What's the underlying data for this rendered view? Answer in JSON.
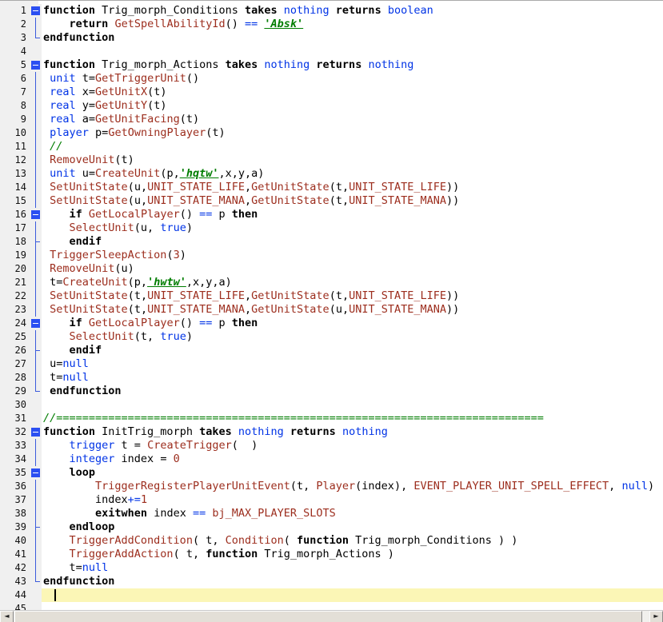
{
  "editor": {
    "current_line": 44,
    "colors": {
      "keyword": "#000000",
      "type": "#0033e6",
      "native": "#9c2d1d",
      "number": "#9c2d1d",
      "rawcode": "#007d00",
      "comment": "#007d00",
      "operator": "#0033e6",
      "plain": "#000000",
      "gutter_bg": "#f0f0f0",
      "gutter_text": "#111111",
      "fold_marker": "#2b4ff2",
      "fold_line": "#3b5bdc",
      "current_line_bg": "#fbf6b6",
      "scrollbar_track": "#f1f0ed",
      "scrollbar_thumb": "#e3dfd7"
    },
    "lines": [
      {
        "n": 1,
        "fold": "box",
        "tokens": [
          [
            "k",
            "function"
          ],
          [
            "p",
            " Trig_morph_Conditions "
          ],
          [
            "k",
            "takes"
          ],
          [
            "p",
            " "
          ],
          [
            "t",
            "nothing"
          ],
          [
            "p",
            " "
          ],
          [
            "k",
            "returns"
          ],
          [
            "p",
            " "
          ],
          [
            "t",
            "boolean"
          ]
        ]
      },
      {
        "n": 2,
        "fold": "line",
        "tokens": [
          [
            "p",
            "    "
          ],
          [
            "k",
            "return"
          ],
          [
            "p",
            " "
          ],
          [
            "f",
            "GetSpellAbilityId"
          ],
          [
            "p",
            "() "
          ],
          [
            "o",
            "=="
          ],
          [
            "p",
            " "
          ],
          [
            "s",
            "'Absk'"
          ]
        ]
      },
      {
        "n": 3,
        "fold": "corner",
        "tokens": [
          [
            "k",
            "endfunction"
          ]
        ]
      },
      {
        "n": 4,
        "fold": "",
        "tokens": []
      },
      {
        "n": 5,
        "fold": "box",
        "tokens": [
          [
            "k",
            "function"
          ],
          [
            "p",
            " Trig_morph_Actions "
          ],
          [
            "k",
            "takes"
          ],
          [
            "p",
            " "
          ],
          [
            "t",
            "nothing"
          ],
          [
            "p",
            " "
          ],
          [
            "k",
            "returns"
          ],
          [
            "p",
            " "
          ],
          [
            "t",
            "nothing"
          ]
        ]
      },
      {
        "n": 6,
        "fold": "line",
        "tokens": [
          [
            "p",
            " "
          ],
          [
            "t",
            "unit"
          ],
          [
            "p",
            " t="
          ],
          [
            "f",
            "GetTriggerUnit"
          ],
          [
            "p",
            "()"
          ]
        ]
      },
      {
        "n": 7,
        "fold": "line",
        "tokens": [
          [
            "p",
            " "
          ],
          [
            "t",
            "real"
          ],
          [
            "p",
            " x="
          ],
          [
            "f",
            "GetUnitX"
          ],
          [
            "p",
            "(t)"
          ]
        ]
      },
      {
        "n": 8,
        "fold": "line",
        "tokens": [
          [
            "p",
            " "
          ],
          [
            "t",
            "real"
          ],
          [
            "p",
            " y="
          ],
          [
            "f",
            "GetUnitY"
          ],
          [
            "p",
            "(t)"
          ]
        ]
      },
      {
        "n": 9,
        "fold": "line",
        "tokens": [
          [
            "p",
            " "
          ],
          [
            "t",
            "real"
          ],
          [
            "p",
            " a="
          ],
          [
            "f",
            "GetUnitFacing"
          ],
          [
            "p",
            "(t)"
          ]
        ]
      },
      {
        "n": 10,
        "fold": "line",
        "tokens": [
          [
            "p",
            " "
          ],
          [
            "t",
            "player"
          ],
          [
            "p",
            " p="
          ],
          [
            "f",
            "GetOwningPlayer"
          ],
          [
            "p",
            "(t)"
          ]
        ]
      },
      {
        "n": 11,
        "fold": "line",
        "tokens": [
          [
            "p",
            " "
          ],
          [
            "m",
            "//"
          ]
        ]
      },
      {
        "n": 12,
        "fold": "line",
        "tokens": [
          [
            "p",
            " "
          ],
          [
            "f",
            "RemoveUnit"
          ],
          [
            "p",
            "(t)"
          ]
        ]
      },
      {
        "n": 13,
        "fold": "line",
        "tokens": [
          [
            "p",
            " "
          ],
          [
            "t",
            "unit"
          ],
          [
            "p",
            " u="
          ],
          [
            "f",
            "CreateUnit"
          ],
          [
            "p",
            "(p,"
          ],
          [
            "s",
            "'hqtw'"
          ],
          [
            "p",
            ",x,y,a)"
          ]
        ]
      },
      {
        "n": 14,
        "fold": "line",
        "tokens": [
          [
            "p",
            " "
          ],
          [
            "f",
            "SetUnitState"
          ],
          [
            "p",
            "(u,"
          ],
          [
            "f",
            "UNIT_STATE_LIFE"
          ],
          [
            "p",
            ","
          ],
          [
            "f",
            "GetUnitState"
          ],
          [
            "p",
            "(t,"
          ],
          [
            "f",
            "UNIT_STATE_LIFE"
          ],
          [
            "p",
            "))"
          ]
        ]
      },
      {
        "n": 15,
        "fold": "line",
        "tokens": [
          [
            "p",
            " "
          ],
          [
            "f",
            "SetUnitState"
          ],
          [
            "p",
            "(u,"
          ],
          [
            "f",
            "UNIT_STATE_MANA"
          ],
          [
            "p",
            ","
          ],
          [
            "f",
            "GetUnitState"
          ],
          [
            "p",
            "(t,"
          ],
          [
            "f",
            "UNIT_STATE_MANA"
          ],
          [
            "p",
            "))"
          ]
        ]
      },
      {
        "n": 16,
        "fold": "box",
        "tokens": [
          [
            "p",
            "    "
          ],
          [
            "k",
            "if"
          ],
          [
            "p",
            " "
          ],
          [
            "f",
            "GetLocalPlayer"
          ],
          [
            "p",
            "() "
          ],
          [
            "o",
            "=="
          ],
          [
            "p",
            " p "
          ],
          [
            "k",
            "then"
          ]
        ]
      },
      {
        "n": 17,
        "fold": "line",
        "tokens": [
          [
            "p",
            "    "
          ],
          [
            "f",
            "SelectUnit"
          ],
          [
            "p",
            "(u, "
          ],
          [
            "t",
            "true"
          ],
          [
            "p",
            ")"
          ]
        ]
      },
      {
        "n": 18,
        "fold": "tee",
        "tokens": [
          [
            "p",
            "    "
          ],
          [
            "k",
            "endif"
          ]
        ]
      },
      {
        "n": 19,
        "fold": "line",
        "tokens": [
          [
            "p",
            " "
          ],
          [
            "f",
            "TriggerSleepAction"
          ],
          [
            "p",
            "("
          ],
          [
            "n",
            "3"
          ],
          [
            "p",
            ")"
          ]
        ]
      },
      {
        "n": 20,
        "fold": "line",
        "tokens": [
          [
            "p",
            " "
          ],
          [
            "f",
            "RemoveUnit"
          ],
          [
            "p",
            "(u)"
          ]
        ]
      },
      {
        "n": 21,
        "fold": "line",
        "tokens": [
          [
            "p",
            " t="
          ],
          [
            "f",
            "CreateUnit"
          ],
          [
            "p",
            "(p,"
          ],
          [
            "s",
            "'hwtw'"
          ],
          [
            "p",
            ",x,y,a)"
          ]
        ]
      },
      {
        "n": 22,
        "fold": "line",
        "tokens": [
          [
            "p",
            " "
          ],
          [
            "f",
            "SetUnitState"
          ],
          [
            "p",
            "(t,"
          ],
          [
            "f",
            "UNIT_STATE_LIFE"
          ],
          [
            "p",
            ","
          ],
          [
            "f",
            "GetUnitState"
          ],
          [
            "p",
            "(t,"
          ],
          [
            "f",
            "UNIT_STATE_LIFE"
          ],
          [
            "p",
            "))"
          ]
        ]
      },
      {
        "n": 23,
        "fold": "line",
        "tokens": [
          [
            "p",
            " "
          ],
          [
            "f",
            "SetUnitState"
          ],
          [
            "p",
            "(t,"
          ],
          [
            "f",
            "UNIT_STATE_MANA"
          ],
          [
            "p",
            ","
          ],
          [
            "f",
            "GetUnitState"
          ],
          [
            "p",
            "(u,"
          ],
          [
            "f",
            "UNIT_STATE_MANA"
          ],
          [
            "p",
            "))"
          ]
        ]
      },
      {
        "n": 24,
        "fold": "box",
        "tokens": [
          [
            "p",
            "    "
          ],
          [
            "k",
            "if"
          ],
          [
            "p",
            " "
          ],
          [
            "f",
            "GetLocalPlayer"
          ],
          [
            "p",
            "() "
          ],
          [
            "o",
            "=="
          ],
          [
            "p",
            " p "
          ],
          [
            "k",
            "then"
          ]
        ]
      },
      {
        "n": 25,
        "fold": "line",
        "tokens": [
          [
            "p",
            "    "
          ],
          [
            "f",
            "SelectUnit"
          ],
          [
            "p",
            "(t, "
          ],
          [
            "t",
            "true"
          ],
          [
            "p",
            ")"
          ]
        ]
      },
      {
        "n": 26,
        "fold": "tee",
        "tokens": [
          [
            "p",
            "    "
          ],
          [
            "k",
            "endif"
          ]
        ]
      },
      {
        "n": 27,
        "fold": "line",
        "tokens": [
          [
            "p",
            " u="
          ],
          [
            "t",
            "null"
          ]
        ]
      },
      {
        "n": 28,
        "fold": "line",
        "tokens": [
          [
            "p",
            " t="
          ],
          [
            "t",
            "null"
          ]
        ]
      },
      {
        "n": 29,
        "fold": "corner",
        "tokens": [
          [
            "p",
            " "
          ],
          [
            "k",
            "endfunction"
          ]
        ]
      },
      {
        "n": 30,
        "fold": "",
        "tokens": []
      },
      {
        "n": 31,
        "fold": "",
        "tokens": [
          [
            "m",
            "//==========================================================================="
          ]
        ]
      },
      {
        "n": 32,
        "fold": "box",
        "tokens": [
          [
            "k",
            "function"
          ],
          [
            "p",
            " InitTrig_morph "
          ],
          [
            "k",
            "takes"
          ],
          [
            "p",
            " "
          ],
          [
            "t",
            "nothing"
          ],
          [
            "p",
            " "
          ],
          [
            "k",
            "returns"
          ],
          [
            "p",
            " "
          ],
          [
            "t",
            "nothing"
          ]
        ]
      },
      {
        "n": 33,
        "fold": "line",
        "tokens": [
          [
            "p",
            "    "
          ],
          [
            "t",
            "trigger"
          ],
          [
            "p",
            " t = "
          ],
          [
            "f",
            "CreateTrigger"
          ],
          [
            "p",
            "(  )"
          ]
        ]
      },
      {
        "n": 34,
        "fold": "line",
        "tokens": [
          [
            "p",
            "    "
          ],
          [
            "t",
            "integer"
          ],
          [
            "p",
            " index = "
          ],
          [
            "n",
            "0"
          ]
        ]
      },
      {
        "n": 35,
        "fold": "box",
        "tokens": [
          [
            "p",
            "    "
          ],
          [
            "k",
            "loop"
          ]
        ]
      },
      {
        "n": 36,
        "fold": "line",
        "tokens": [
          [
            "p",
            "        "
          ],
          [
            "f",
            "TriggerRegisterPlayerUnitEvent"
          ],
          [
            "p",
            "(t, "
          ],
          [
            "f",
            "Player"
          ],
          [
            "p",
            "(index), "
          ],
          [
            "f",
            "EVENT_PLAYER_UNIT_SPELL_EFFECT"
          ],
          [
            "p",
            ", "
          ],
          [
            "t",
            "null"
          ],
          [
            "p",
            ")"
          ]
        ]
      },
      {
        "n": 37,
        "fold": "line",
        "tokens": [
          [
            "p",
            "        index"
          ],
          [
            "o",
            "+="
          ],
          [
            "n",
            "1"
          ]
        ]
      },
      {
        "n": 38,
        "fold": "line",
        "tokens": [
          [
            "p",
            "        "
          ],
          [
            "k",
            "exitwhen"
          ],
          [
            "p",
            " index "
          ],
          [
            "o",
            "=="
          ],
          [
            "p",
            " "
          ],
          [
            "f",
            "bj_MAX_PLAYER_SLOTS"
          ]
        ]
      },
      {
        "n": 39,
        "fold": "tee",
        "tokens": [
          [
            "p",
            "    "
          ],
          [
            "k",
            "endloop"
          ]
        ]
      },
      {
        "n": 40,
        "fold": "line",
        "tokens": [
          [
            "p",
            "    "
          ],
          [
            "f",
            "TriggerAddCondition"
          ],
          [
            "p",
            "( t, "
          ],
          [
            "f",
            "Condition"
          ],
          [
            "p",
            "( "
          ],
          [
            "k",
            "function"
          ],
          [
            "p",
            " Trig_morph_Conditions ) )"
          ]
        ]
      },
      {
        "n": 41,
        "fold": "line",
        "tokens": [
          [
            "p",
            "    "
          ],
          [
            "f",
            "TriggerAddAction"
          ],
          [
            "p",
            "( t, "
          ],
          [
            "k",
            "function"
          ],
          [
            "p",
            " Trig_morph_Actions )"
          ]
        ]
      },
      {
        "n": 42,
        "fold": "line",
        "tokens": [
          [
            "p",
            "    t="
          ],
          [
            "t",
            "null"
          ]
        ]
      },
      {
        "n": 43,
        "fold": "corner",
        "tokens": [
          [
            "k",
            "endfunction"
          ]
        ]
      },
      {
        "n": 44,
        "fold": "",
        "tokens": []
      },
      {
        "n": 45,
        "fold": "",
        "tokens": []
      }
    ]
  },
  "scrollbar": {
    "left_arrow": "◄",
    "right_arrow": "►"
  }
}
